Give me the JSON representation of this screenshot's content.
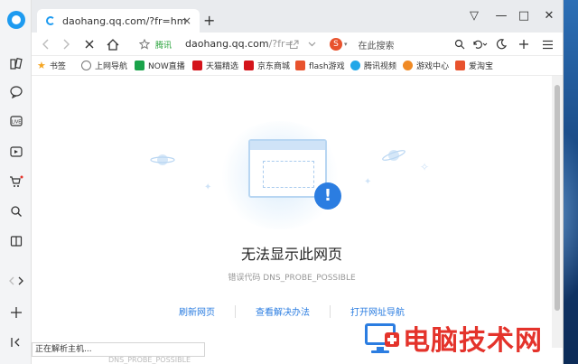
{
  "tab": {
    "title": "daohang.qq.com/?fr=hmpage",
    "close": "×",
    "new_tab": "+"
  },
  "window_controls": [
    "▽",
    "—",
    "□",
    "✕"
  ],
  "address": {
    "trust_badge": "腾讯",
    "host": "daohang.qq.com",
    "path": "/?fr="
  },
  "search": {
    "engine": "S",
    "placeholder": "在此搜索"
  },
  "bookmarks": [
    {
      "label": "书签",
      "color": "#f5a623"
    },
    {
      "label": "上网导航",
      "color": "#777777"
    },
    {
      "label": "NOW直播",
      "color": "#1aa34a"
    },
    {
      "label": "天猫精选",
      "color": "#d4141b"
    },
    {
      "label": "京东商城",
      "color": "#d4141b"
    },
    {
      "label": "flash游戏",
      "color": "#e8522d"
    },
    {
      "label": "腾讯视频",
      "color": "#21a7e8"
    },
    {
      "label": "游戏中心",
      "color": "#f08a24"
    },
    {
      "label": "爱淘宝",
      "color": "#e8522d"
    }
  ],
  "error": {
    "title": "无法显示此网页",
    "code": "错误代码 DNS_PROBE_POSSIBLE",
    "links": [
      "刷新网页",
      "查看解决办法",
      "打开网址导航"
    ]
  },
  "status": {
    "text": "正在解析主机...",
    "ghost": "DNS_PROBE_POSSIBLE"
  },
  "watermark": {
    "text": "电脑技术网"
  },
  "colors": {
    "accent": "#2b7de1",
    "brand": "#1e9bf0",
    "watermark": "#e4332b"
  }
}
